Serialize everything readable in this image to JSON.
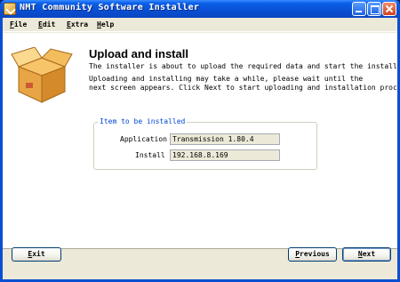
{
  "window": {
    "title": "NMT Community Software Installer"
  },
  "menu": [
    {
      "key": "F",
      "rest": "ile"
    },
    {
      "key": "E",
      "rest": "dit"
    },
    {
      "key": "E",
      "rest": "xtra"
    },
    {
      "key": "H",
      "rest": "elp"
    }
  ],
  "page": {
    "heading": "Upload and install",
    "description1": "The installer is about to upload the required data and start the installatio",
    "description2_line1": "Uploading and installing may take a while, please wait until the",
    "description2_line2": "next screen appears. Click Next to start uploading and installation process."
  },
  "group": {
    "legend": "Item to be installed",
    "application_label": "Application",
    "application_value": "Transmission 1.80.4",
    "install_label": "Install o",
    "install_value": "192.168.8.169"
  },
  "buttons": {
    "exit": {
      "key": "E",
      "rest": "xit"
    },
    "previous": {
      "key": "P",
      "rest": "revious"
    },
    "next": {
      "key": "N",
      "rest": "ext"
    }
  },
  "colors": {
    "titlebar": "#0a4fd2",
    "legend": "#0046d5",
    "field_bg": "#ece9d8"
  }
}
